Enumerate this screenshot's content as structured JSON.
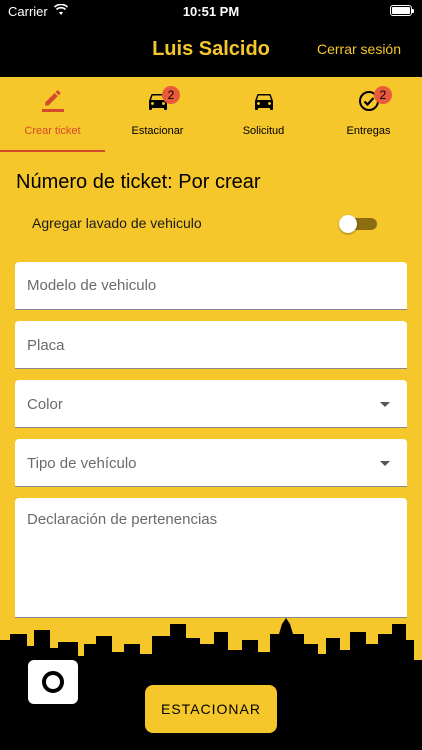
{
  "status_bar": {
    "carrier": "Carrier",
    "time": "10:51 PM"
  },
  "app_bar": {
    "title": "Luis Salcido",
    "logout_label": "Cerrar sesión"
  },
  "tabs": [
    {
      "label": "Crear ticket",
      "icon": "edit-icon",
      "active": true,
      "badge": null
    },
    {
      "label": "Estacionar",
      "icon": "car-icon",
      "active": false,
      "badge": "2"
    },
    {
      "label": "Solicitud",
      "icon": "car-icon",
      "active": false,
      "badge": null
    },
    {
      "label": "Entregas",
      "icon": "check-circle-icon",
      "active": false,
      "badge": "2"
    }
  ],
  "form": {
    "ticket_title": "Número de ticket: Por crear",
    "wash_toggle": {
      "label": "Agregar lavado de vehiculo",
      "on": false
    },
    "vehicle_model": {
      "placeholder": "Modelo de vehiculo"
    },
    "plate": {
      "placeholder": "Placa"
    },
    "color": {
      "placeholder": "Color"
    },
    "vehicle_type": {
      "placeholder": "Tipo de vehículo"
    },
    "belongings": {
      "placeholder": "Declaración de pertenencias"
    }
  },
  "actions": {
    "camera": "camera-icon",
    "park_label": "ESTACIONAR"
  },
  "colors": {
    "brand_yellow": "#f6c72b",
    "black": "#000000",
    "active_tab": "#d64a2c",
    "badge": "#e85a3c"
  }
}
